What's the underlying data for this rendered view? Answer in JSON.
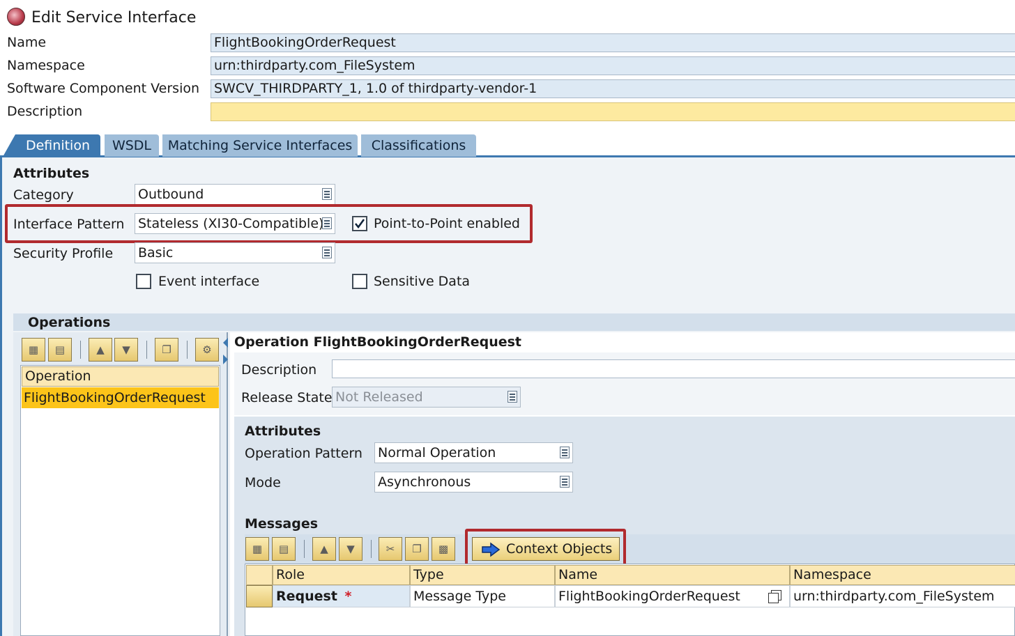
{
  "window": {
    "title": "Edit Service Interface"
  },
  "header": {
    "name_label": "Name",
    "name_value": "FlightBookingOrderRequest",
    "namespace_label": "Namespace",
    "namespace_value": "urn:thirdparty.com_FileSystem",
    "swcv_label": "Software Component Version",
    "swcv_value": "SWCV_THIRDPARTY_1, 1.0 of thirdparty-vendor-1",
    "description_label": "Description",
    "description_value": ""
  },
  "tabs": [
    {
      "label": "Definition",
      "active": true
    },
    {
      "label": "WSDL",
      "active": false
    },
    {
      "label": "Matching Service Interfaces",
      "active": false
    },
    {
      "label": "Classifications",
      "active": false
    }
  ],
  "attributes": {
    "title": "Attributes",
    "category_label": "Category",
    "category_value": "Outbound",
    "pattern_label": "Interface Pattern",
    "pattern_value": "Stateless (XI30-Compatible)",
    "p2p_label": "Point-to-Point enabled",
    "p2p_checked": true,
    "security_label": "Security Profile",
    "security_value": "Basic",
    "event_label": "Event interface",
    "event_checked": false,
    "sensitive_label": "Sensitive Data",
    "sensitive_checked": false
  },
  "operations": {
    "title": "Operations",
    "list_header": "Operation",
    "items": [
      "FlightBookingOrderRequest"
    ],
    "selected_index": 0
  },
  "operation_detail": {
    "title": "Operation FlightBookingOrderRequest",
    "description_label": "Description",
    "description_value": "",
    "release_label": "Release State",
    "release_value": "Not Released",
    "attributes_title": "Attributes",
    "op_pattern_label": "Operation Pattern",
    "op_pattern_value": "Normal Operation",
    "mode_label": "Mode",
    "mode_value": "Asynchronous"
  },
  "messages": {
    "title": "Messages",
    "context_button": "Context Objects",
    "columns": [
      "Role",
      "Type",
      "Name",
      "Namespace"
    ],
    "rows": [
      {
        "role": "Request",
        "required_marker": "*",
        "type": "Message Type",
        "name": "FlightBookingOrderRequest",
        "namespace": "urn:thirdparty.com_FileSystem"
      }
    ]
  },
  "colors": {
    "tab_active": "#3d78b0",
    "highlight_box": "#b12a2e",
    "selected_row": "#fcc419",
    "editable_field": "#fdeaa0"
  },
  "icons": [
    "window-logo-icon",
    "value-help-icon",
    "checkmark-icon",
    "arrow-right-icon"
  ]
}
